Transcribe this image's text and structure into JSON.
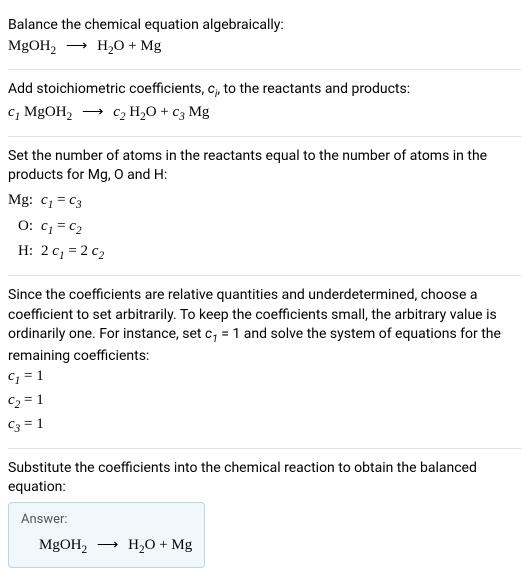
{
  "section1": {
    "prompt": "Balance the chemical equation algebraically:",
    "lhs1": "MgOH",
    "lhs1_sub": "2",
    "arrow": "⟶",
    "rhs1a": "H",
    "rhs1a_sub": "2",
    "rhs1b": "O + Mg"
  },
  "section2": {
    "text1": "Add stoichiometric coefficients, ",
    "ci_c": "c",
    "ci_isub": "i",
    "text2": ", to the reactants and products:",
    "c1": "c",
    "c1sub": "1",
    "sp1": " MgOH",
    "sp1sub": "2",
    "arrow": "⟶",
    "c2": "c",
    "c2sub": "2",
    "sp2a": " H",
    "sp2asub": "2",
    "sp2b": "O + ",
    "c3": "c",
    "c3sub": "3",
    "sp3": " Mg"
  },
  "section3": {
    "intro": "Set the number of atoms in the reactants equal to the number of atoms in the products for Mg, O and H:",
    "rows": [
      {
        "elem": "Mg: ",
        "lhsc": "c",
        "lhssub": "1",
        "eq": " = ",
        "rhsc": "c",
        "rhssub": "3"
      },
      {
        "elem": "O: ",
        "lhsc": "c",
        "lhssub": "1",
        "eq": " = ",
        "rhsc": "c",
        "rhssub": "2"
      },
      {
        "elem": "H: ",
        "lpre": "2 ",
        "lhsc": "c",
        "lhssub": "1",
        "eq": " = ",
        "rpre": "2 ",
        "rhsc": "c",
        "rhssub": "2"
      }
    ]
  },
  "section4": {
    "text1": "Since the coefficients are relative quantities and underdetermined, choose a coefficient to set arbitrarily. To keep the coefficients small, the arbitrary value is ordinarily one. For instance, set ",
    "setc": "c",
    "setsub": "1",
    "seteq": " = 1",
    "text2": " and solve the system of equations for the remaining coefficients:",
    "results": [
      {
        "c": "c",
        "sub": "1",
        "val": " = 1"
      },
      {
        "c": "c",
        "sub": "2",
        "val": " = 1"
      },
      {
        "c": "c",
        "sub": "3",
        "val": " = 1"
      }
    ]
  },
  "section5": {
    "text": "Substitute the coefficients into the chemical reaction to obtain the balanced equation:",
    "answer_label": "Answer:",
    "lhs": "MgOH",
    "lhssub": "2",
    "arrow": "⟶",
    "rhs_a": "H",
    "rhs_asub": "2",
    "rhs_b": "O + Mg"
  }
}
